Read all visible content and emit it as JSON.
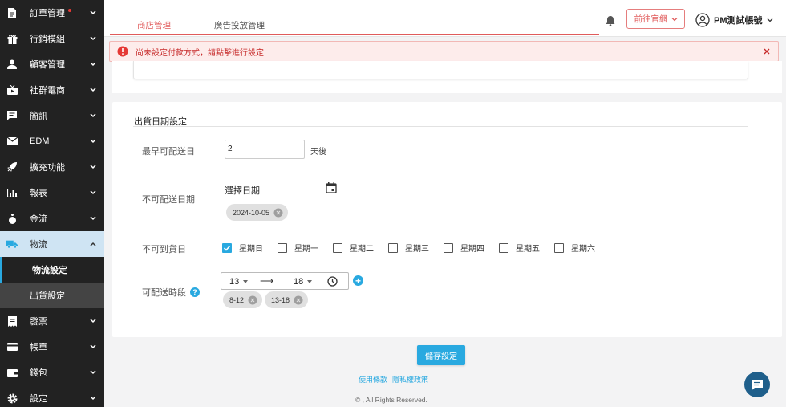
{
  "sidebar": {
    "items": [
      {
        "label": "訂單管理",
        "icon": "document-icon",
        "badge": true
      },
      {
        "label": "行銷模組",
        "icon": "gift-icon"
      },
      {
        "label": "顧客管理",
        "icon": "person-icon"
      },
      {
        "label": "社群電商",
        "icon": "tv-icon"
      },
      {
        "label": "簡訊",
        "icon": "message-icon"
      },
      {
        "label": "EDM",
        "icon": "mail-icon"
      },
      {
        "label": "擴充功能",
        "icon": "rocket-icon"
      },
      {
        "label": "報表",
        "icon": "bar-chart-icon"
      },
      {
        "label": "金流",
        "icon": "money-bag-icon"
      },
      {
        "label": "物流",
        "icon": "truck-icon"
      }
    ],
    "subitems": [
      {
        "label": "物流設定"
      },
      {
        "label": "出貨設定"
      }
    ],
    "items_after": [
      {
        "label": "發票",
        "icon": "receipt-icon"
      },
      {
        "label": "帳單",
        "icon": "card-icon"
      },
      {
        "label": "錢包",
        "icon": "wallet-icon"
      },
      {
        "label": "設定",
        "icon": "gear-icon"
      }
    ]
  },
  "header": {
    "tabs": [
      {
        "label": "商店管理"
      },
      {
        "label": "廣告投放管理"
      }
    ],
    "goto_label": "前往官網",
    "user_name": "PM測試帳號"
  },
  "alert": {
    "text": "尚未設定付款方式，請點擊進行設定",
    "color": "#c62828"
  },
  "shipping": {
    "title": "出貨日期設定",
    "earliest_label": "最早可配送日",
    "earliest_value": "2",
    "earliest_suffix": "天後",
    "unavailable_label": "不可配送日期",
    "date_placeholder": "選擇日期",
    "unavailable_dates": [
      "2024-10-05"
    ],
    "no_arrival_label": "不可到貨日",
    "weekdays": [
      {
        "label": "星期日",
        "checked": true
      },
      {
        "label": "星期一",
        "checked": false
      },
      {
        "label": "星期二",
        "checked": false
      },
      {
        "label": "星期三",
        "checked": false
      },
      {
        "label": "星期四",
        "checked": false
      },
      {
        "label": "星期五",
        "checked": false
      },
      {
        "label": "星期六",
        "checked": false
      }
    ],
    "timeslot_label": "可配送時段",
    "time_start": "13",
    "time_end": "18",
    "time_arrow": "⟶",
    "timeslots": [
      "8-12",
      "13-18"
    ]
  },
  "save_label": "儲存設定",
  "footer": {
    "terms": "使用條款",
    "privacy": "隱私權政策",
    "copyright": "© , All Rights Reserved."
  },
  "colors": {
    "accent": "#29a9e0",
    "brand_red": "#e05b5b",
    "sidebar_bg": "#222222"
  }
}
